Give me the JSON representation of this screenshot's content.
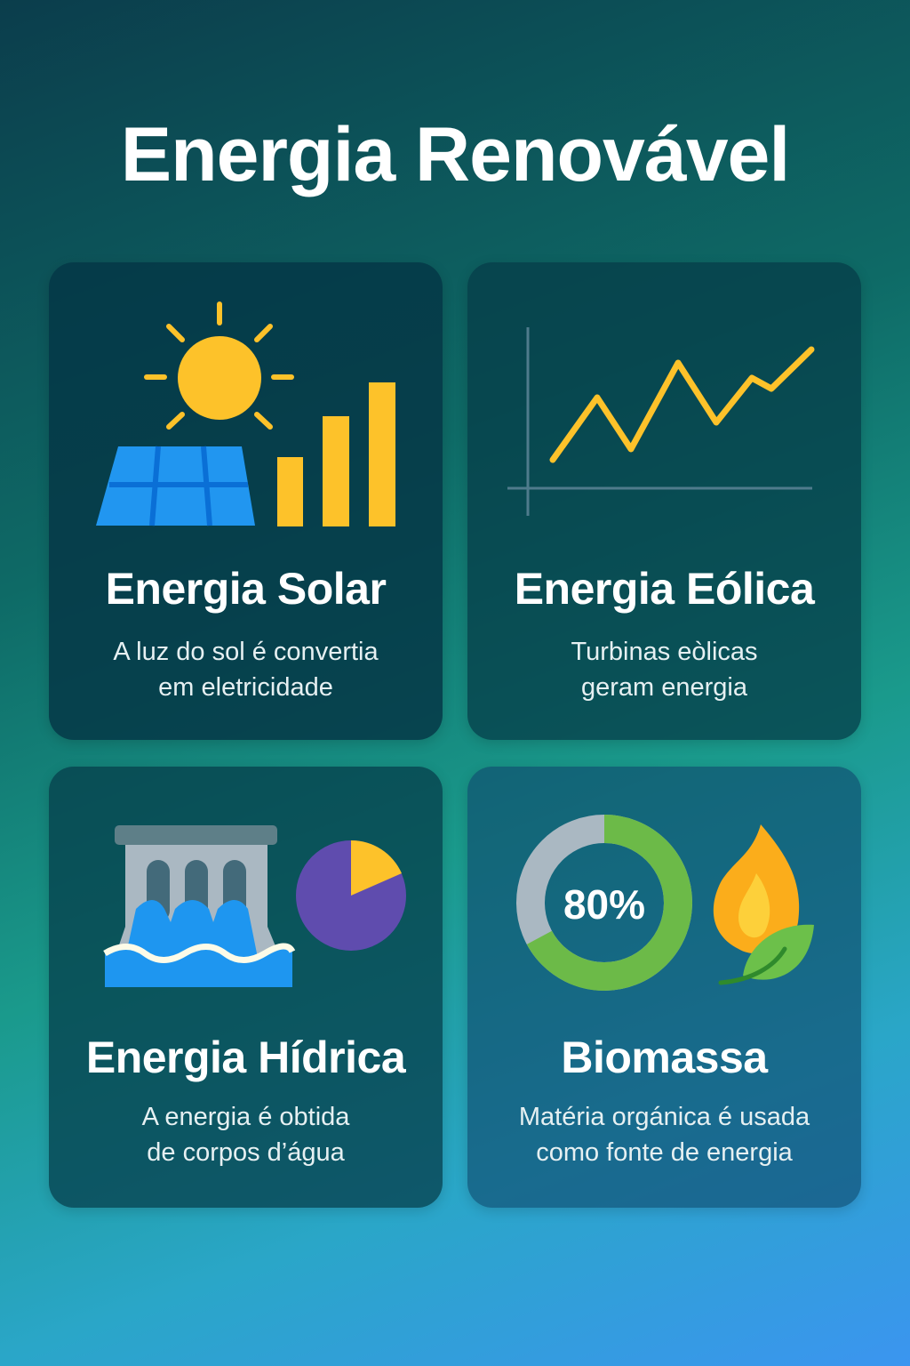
{
  "title": "Energia Renovável",
  "cards": [
    {
      "title": "Energia Solar",
      "desc_line1": "A luz do sol é convertia",
      "desc_line2": "em eletricidade",
      "icon": "solar-panel-icon"
    },
    {
      "title": "Energia Eólica",
      "desc_line1": "Turbinas eòlicas",
      "desc_line2": "geram energia",
      "icon": "line-chart-icon"
    },
    {
      "title": "Energia Hídrica",
      "desc_line1": "A energia é obtida",
      "desc_line2": "de corpos d’água",
      "icon": "dam-icon"
    },
    {
      "title": "Biomassa",
      "desc_line1": "Matéria orgánica é usada",
      "desc_line2": "como fonte de energia",
      "icon": "flame-leaf-icon",
      "donut_label": "80%"
    }
  ],
  "colors": {
    "yellow": "#fdc22a",
    "blue": "#1e96f0",
    "green": "#6cba48",
    "purple": "#5f4cae",
    "gray": "#aab8c2"
  }
}
